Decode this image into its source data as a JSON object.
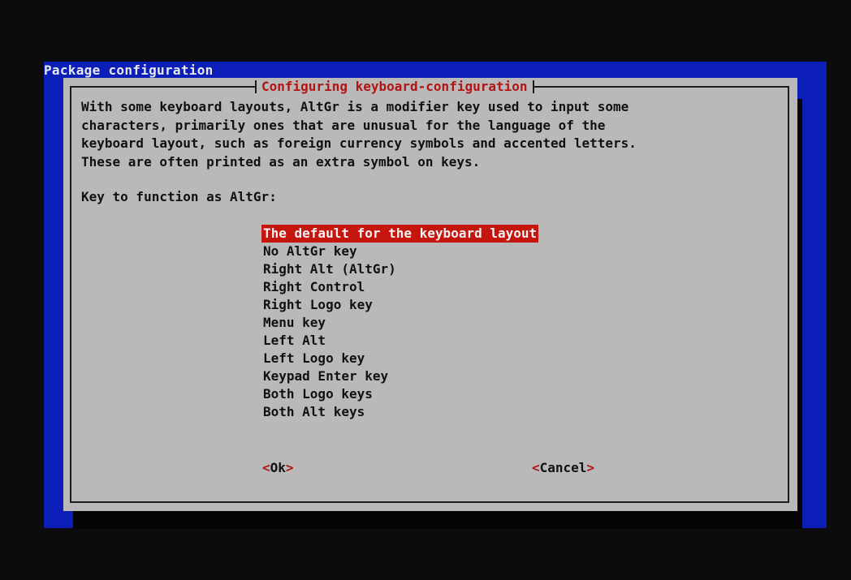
{
  "backtitle": "Package configuration",
  "dialog": {
    "title": "Configuring keyboard-configuration",
    "description": [
      "With some keyboard layouts, AltGr is a modifier key used to input some",
      "characters, primarily ones that are unusual for the language of the",
      "keyboard layout, such as foreign currency symbols and accented letters.",
      "These are often printed as an extra symbol on keys."
    ],
    "prompt": "Key to function as AltGr:",
    "options": [
      {
        "label": "The default for the keyboard layout",
        "selected": true
      },
      {
        "label": "No AltGr key"
      },
      {
        "label": "Right Alt (AltGr)"
      },
      {
        "label": "Right Control"
      },
      {
        "label": "Right Logo key"
      },
      {
        "label": "Menu key"
      },
      {
        "label": "Left Alt"
      },
      {
        "label": "Left Logo key"
      },
      {
        "label": "Keypad Enter key"
      },
      {
        "label": "Both Logo keys"
      },
      {
        "label": "Both Alt keys"
      }
    ],
    "buttons": {
      "ok": "Ok",
      "cancel": "Cancel"
    }
  },
  "colors": {
    "screen_bg": "#0b1fb8",
    "dialog_bg": "#b9b9b9",
    "highlight": "#c4150e",
    "title_text": "#b11414"
  }
}
